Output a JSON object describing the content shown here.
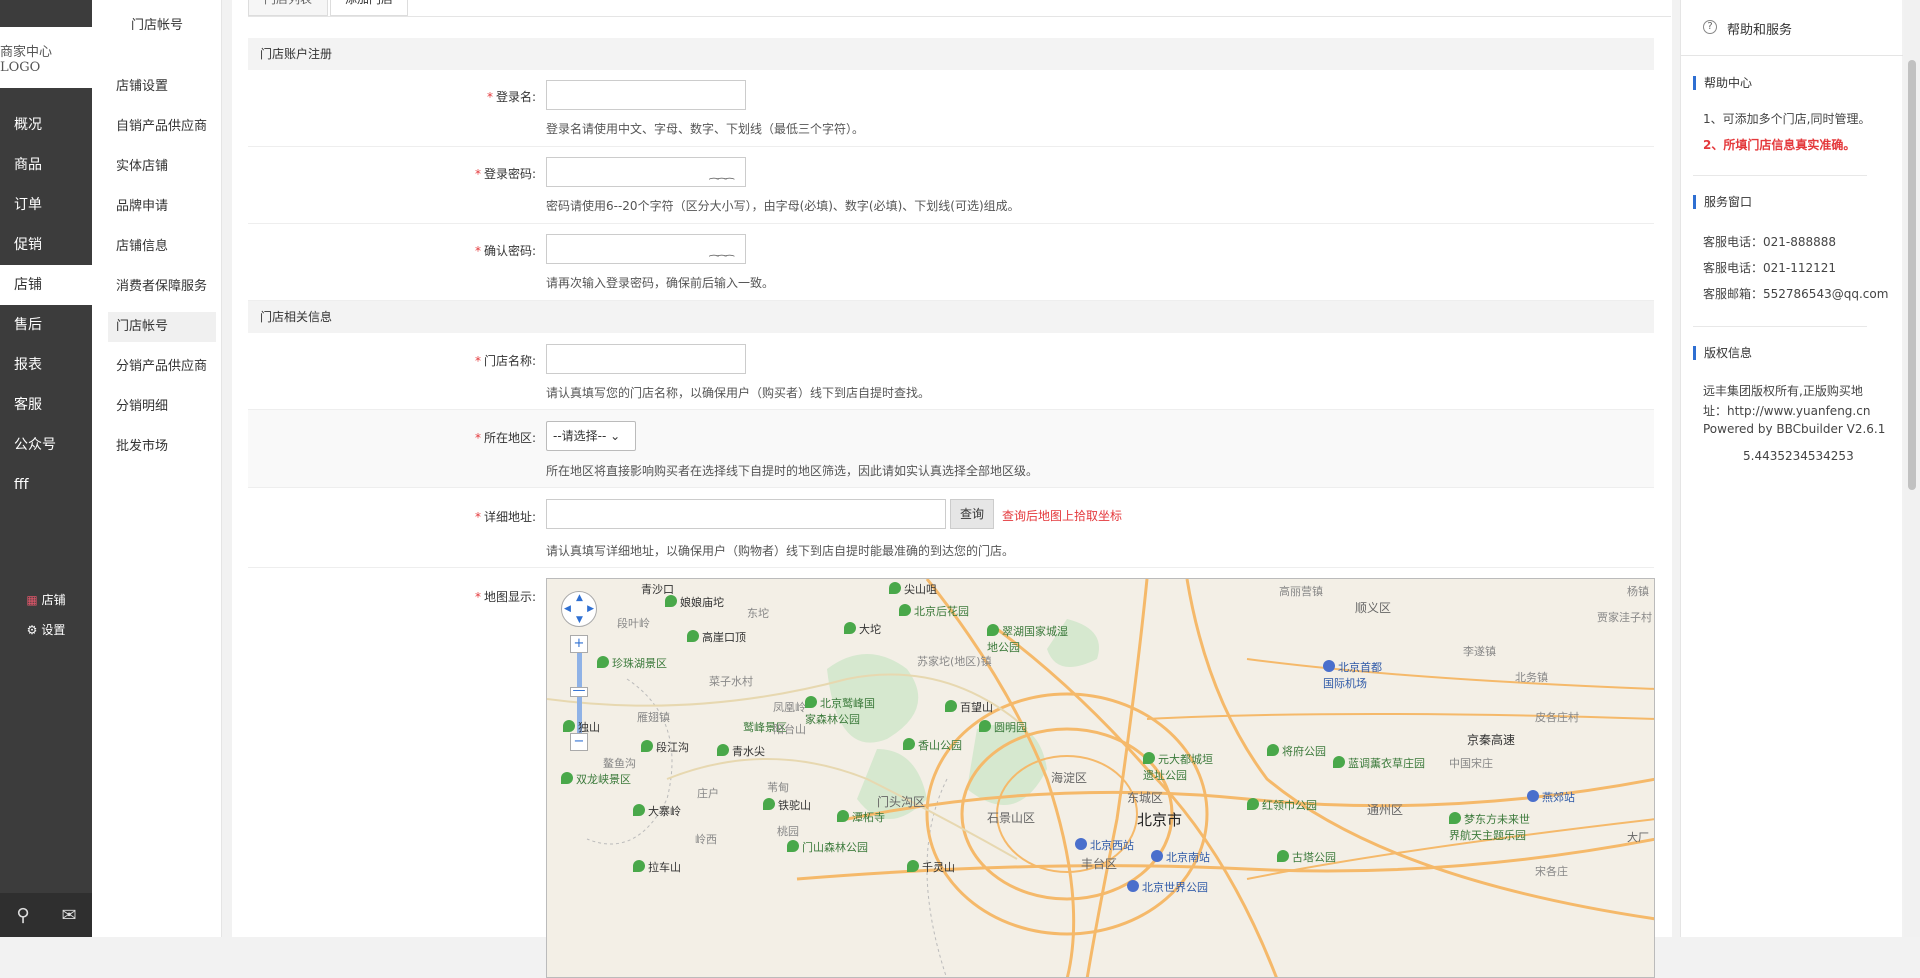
{
  "logo": {
    "text": "商家中心LOGO"
  },
  "nav": {
    "items": [
      "概况",
      "商品",
      "订单",
      "促销",
      "店铺",
      "售后",
      "报表",
      "客服",
      "公众号",
      "fff"
    ],
    "active": "店铺",
    "bottom": {
      "store": "店铺",
      "settings": "设置"
    }
  },
  "subnav": {
    "title": "门店帐号",
    "items": [
      "店铺设置",
      "自销产品供应商",
      "实体店铺",
      "品牌申请",
      "店铺信息",
      "消费者保障服务",
      "门店帐号",
      "分销产品供应商",
      "分销明细",
      "批发市场"
    ],
    "active": "门店帐号"
  },
  "tabs": [
    "门店列表",
    "添加门店"
  ],
  "form": {
    "section1": "门店账户注册",
    "login_name": {
      "label": "登录名:",
      "hint": "登录名请使用中文、字母、数字、下划线（最低三个字符）。"
    },
    "password": {
      "label": "登录密码:",
      "hint": "密码请使用6--20个字符（区分大小写），由字母(必填)、数字(必填)、下划线(可选)组成。"
    },
    "confirm": {
      "label": "确认密码:",
      "hint": "请再次输入登录密码，确保前后输入一致。"
    },
    "section2": "门店相关信息",
    "store_name": {
      "label": "门店名称:",
      "hint": "请认真填写您的门店名称，以确保用户（购买者）线下到店自提时查找。"
    },
    "region": {
      "label": "所在地区:",
      "select": "--请选择--",
      "hint": "所在地区将直接影响购买者在选择线下自提时的地区筛选，因此请如实认真选择全部地区级。"
    },
    "address": {
      "label": "详细地址:",
      "button": "查询",
      "link": "查询后地图上拾取坐标",
      "hint": "请认真填写详细地址，以确保用户（购物者）线下到店自提时能最准确的到达您的门店。"
    },
    "map": {
      "label": "地图显示:"
    }
  },
  "map_labels": {
    "places": [
      "青沙口",
      "娘娘庙坨",
      "尖山咀",
      "北京后花园",
      "大坨",
      "东坨",
      "翠湖国家城湿地公园",
      "段叶岭",
      "高崖口顶",
      "珍珠湖景区",
      "苏家坨(地区)镇",
      "菜子水村",
      "北京鹫峰国家森林公园",
      "凤凰岭",
      "百望山",
      "圆明园",
      "鹫峰景区",
      "阳台山",
      "独山",
      "雁翅镇",
      "段江沟",
      "青水尖",
      "香山公园",
      "鳌鱼沟",
      "双龙峡景区",
      "庄户",
      "苇甸",
      "门头沟区",
      "海淀区",
      "元大都城垣遗址公园",
      "将府公园",
      "蓝调薰衣草庄园",
      "中国宋庄",
      "大寨岭",
      "铁驼山",
      "潭柘寺",
      "石景山区",
      "东城区",
      "北京市",
      "红领巾公园",
      "通州区",
      "梦东方未来世界航天主题乐园",
      "岭西",
      "桃园",
      "门山森林公园",
      "北京西站",
      "北京南站",
      "古塔公园",
      "丰台区",
      "拉车山",
      "千灵山",
      "宋各庄",
      "大厂",
      "高丽营镇",
      "顺义区",
      "北京首都国际机场",
      "李遂镇",
      "北务镇",
      "皮各庄村",
      "京秦高速",
      "贾家洼子村",
      "杨镇",
      "燕郊站",
      "北京世界公园"
    ]
  },
  "help": {
    "title": "帮助和服务",
    "center": {
      "title": "帮助中心",
      "lines": [
        "1、可添加多个门店,同时管理。",
        "2、所填门店信息真实准确。"
      ]
    },
    "service": {
      "title": "服务窗口",
      "lines": [
        "客服电话：021-888888",
        "客服电话：021-112121",
        "客服邮箱：552786543@qq.com"
      ]
    },
    "copyright": {
      "title": "版权信息",
      "lines": [
        "远丰集团版权所有,正版购买地",
        "址：http://www.yuanfeng.cn",
        "Powered by BBCbuilder V2.6.1",
        "5.4435234534253"
      ]
    }
  }
}
